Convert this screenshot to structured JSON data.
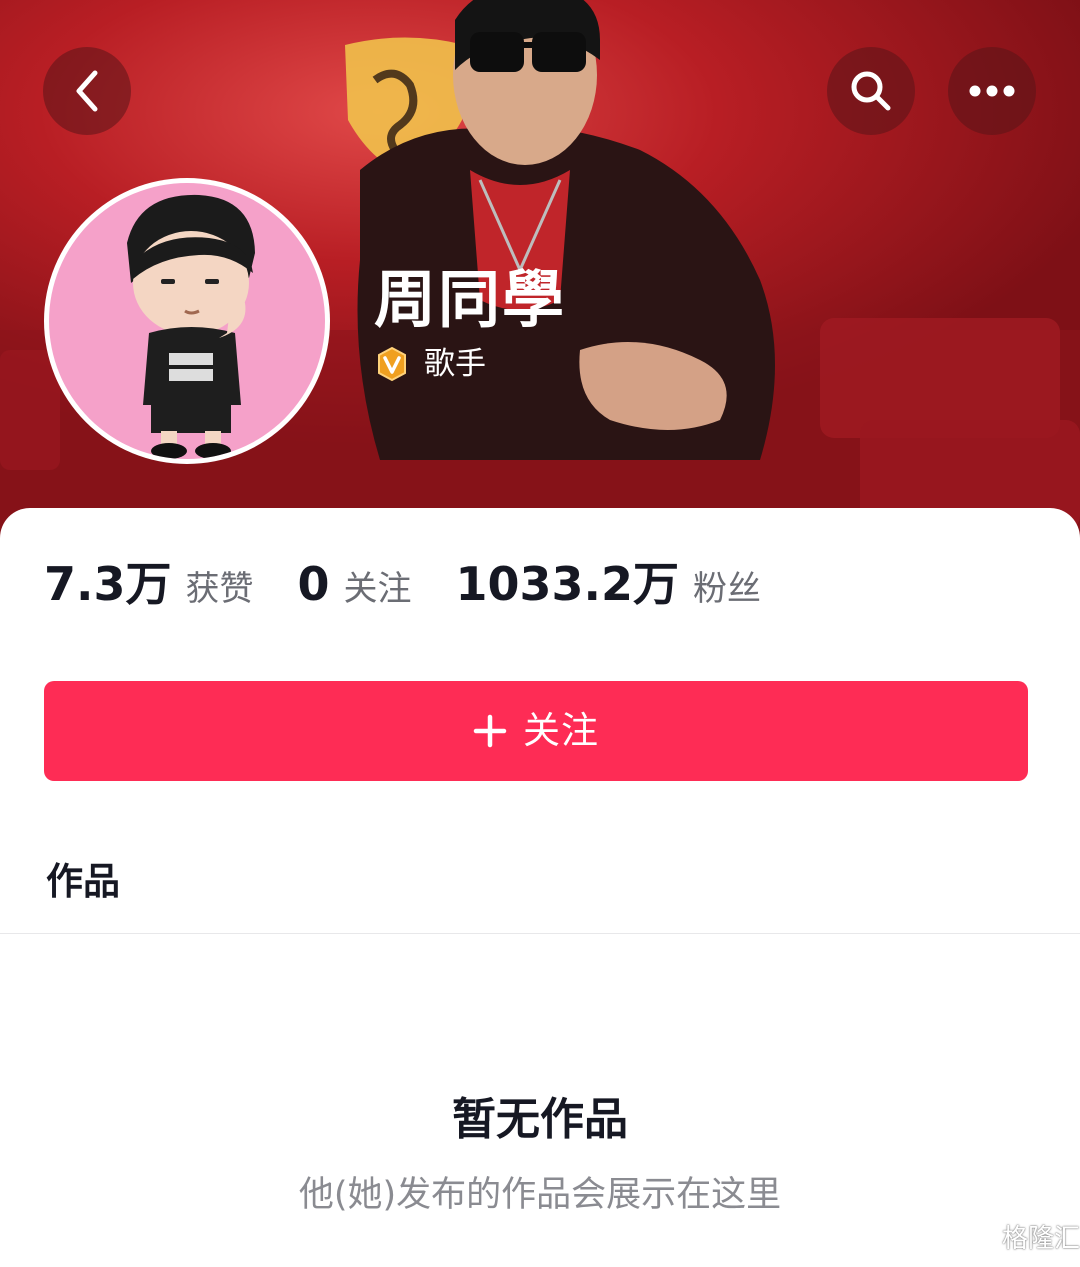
{
  "header": {
    "back_icon": "chevron-left-icon",
    "search_icon": "search-icon",
    "more_icon": "more-horizontal-icon"
  },
  "profile": {
    "name": "周同學",
    "verify_badge_icon": "verified-v-badge-icon",
    "verify_label": "歌手",
    "avatar_icon": "cartoon-avatar"
  },
  "stats": [
    {
      "value": "7.3万",
      "label": "获赞"
    },
    {
      "value": "0",
      "label": "关注"
    },
    {
      "value": "1033.2万",
      "label": "粉丝"
    }
  ],
  "follow_button": {
    "icon": "plus-icon",
    "label": "关注"
  },
  "tabs": {
    "works": "作品"
  },
  "empty_state": {
    "title": "暂无作品",
    "subtitle": "他(她)发布的作品会展示在这里"
  },
  "watermark": {
    "text": "格隆汇"
  },
  "colors": {
    "accent": "#fe2c55",
    "hero_red": "#b81e24",
    "avatar_bg": "#f5a1c9",
    "badge": "#f0a020"
  }
}
